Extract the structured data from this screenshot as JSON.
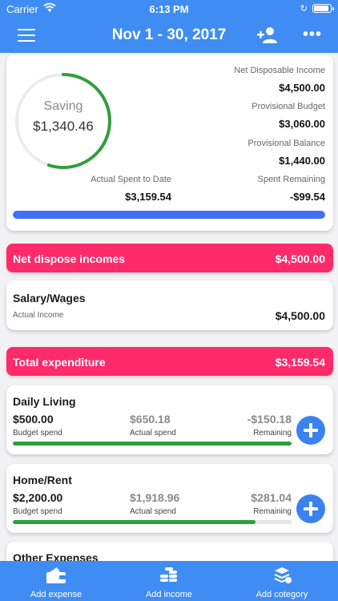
{
  "status": {
    "carrier": "Carrier",
    "time": "6:13 PM"
  },
  "nav": {
    "title": "Nov 1 - 30, 2017",
    "more": "•••"
  },
  "summary": {
    "ring_label": "Saving",
    "ring_value": "$1,340.46",
    "ring_fraction": 0.55,
    "net_income_label": "Net Disposable Income",
    "net_income_value": "$4,500.00",
    "prov_budget_label": "Provisional Budget",
    "prov_budget_value": "$3,060.00",
    "prov_balance_label": "Provisional Balance",
    "prov_balance_value": "$1,440.00",
    "spent_label": "Actual Spent to Date",
    "spent_value": "$3,159.54",
    "remaining_label": "Spent Remaining",
    "remaining_value": "-$99.54",
    "progress_percent": 100
  },
  "income_header": {
    "label": "Net dispose incomes",
    "value": "$4,500.00"
  },
  "salary": {
    "name": "Salary/Wages",
    "sub": "Actual Income",
    "value": "$4,500.00"
  },
  "expense_header": {
    "label": "Total expenditure",
    "value": "$3,159.54"
  },
  "categories": [
    {
      "name": "Daily Living",
      "budget": "$500.00",
      "budget_cap": "Budget spend",
      "actual": "$650.18",
      "actual_cap": "Actual spend",
      "remaining": "-$150.18",
      "remaining_cap": "Remaining",
      "progress_percent": 100
    },
    {
      "name": "Home/Rent",
      "budget": "$2,200.00",
      "budget_cap": "Budget spend",
      "actual": "$1,918.96",
      "actual_cap": "Actual spend",
      "remaining": "$281.04",
      "remaining_cap": "Remaining",
      "progress_percent": 87
    },
    {
      "name": "Other Expenses"
    }
  ],
  "tabs": [
    {
      "label": "Add expense",
      "icon": "wallet-icon"
    },
    {
      "label": "Add income",
      "icon": "coins-icon"
    },
    {
      "label": "Add cotegory",
      "icon": "layers-icon"
    }
  ],
  "colors": {
    "primary": "#3f8df2",
    "accent": "#ff2a6a",
    "success": "#2f9e3b",
    "progress": "#3f6ff2"
  }
}
